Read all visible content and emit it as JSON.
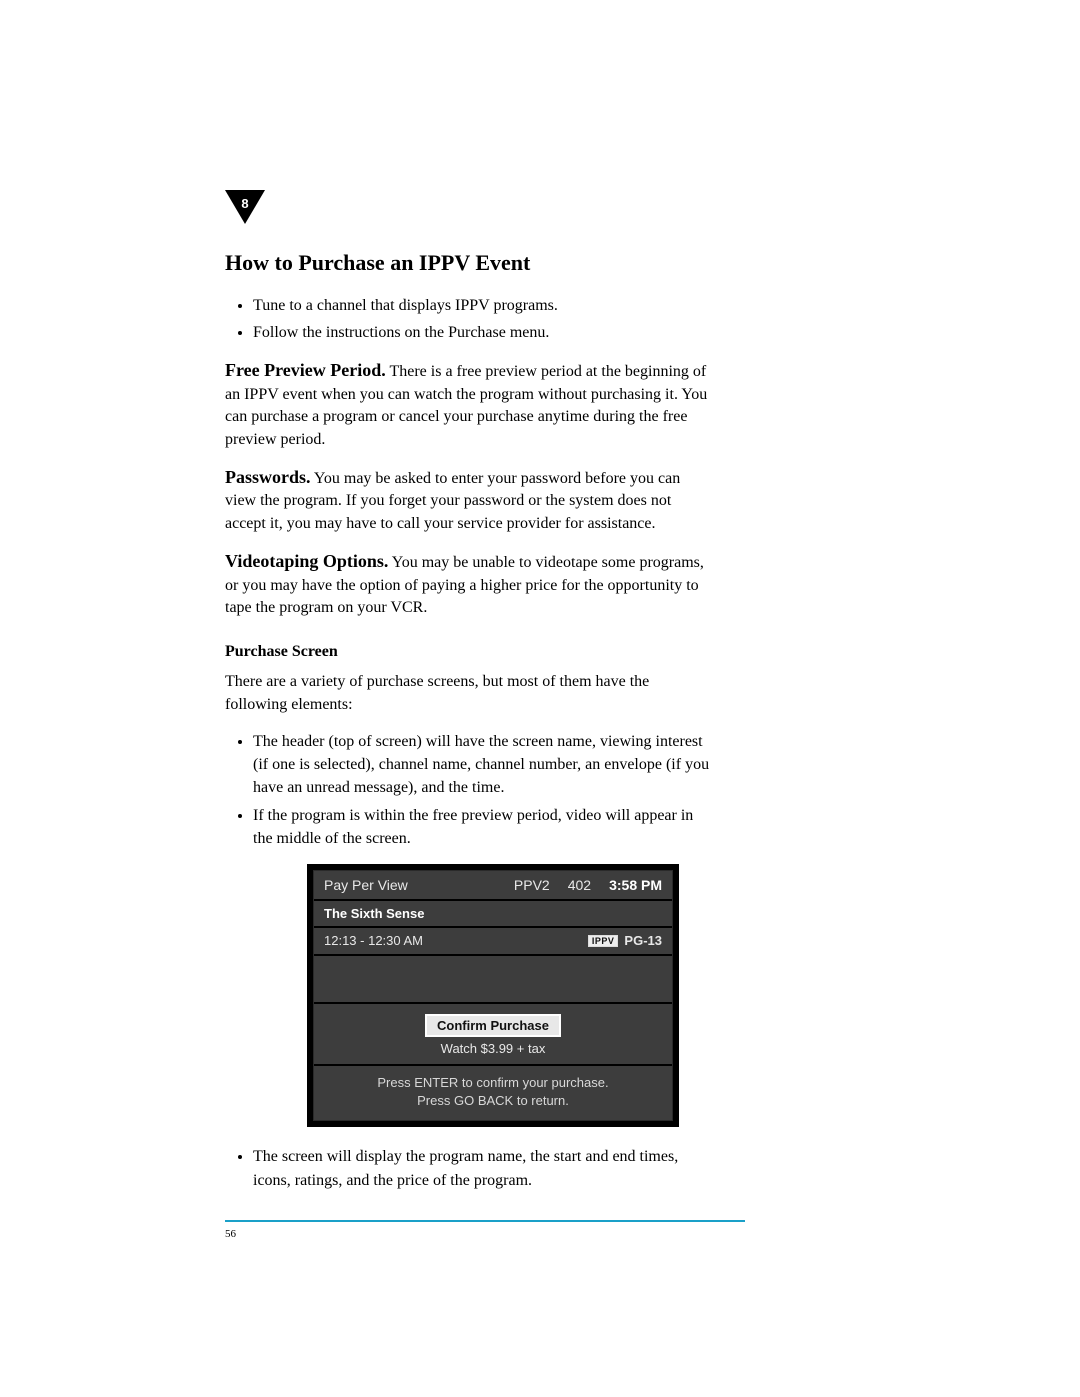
{
  "chapter_number": "8",
  "page_number": "56",
  "heading": "How to Purchase an IPPV Event",
  "intro_bullets": [
    "Tune to a channel that displays IPPV programs.",
    "Follow the instructions on the Purchase menu."
  ],
  "paragraphs": {
    "free_preview": {
      "runin": "Free Preview Period.",
      "body": " There is a free preview period at the beginning of an IPPV event when you can watch the program without purchasing it. You can purchase a program or cancel your purchase anytime during the free preview period."
    },
    "passwords": {
      "runin": "Passwords.",
      "body": " You may be asked to enter your password before you can view the program. If you forget your password or the system does not accept it, you may have to call your service provider for assistance."
    },
    "videotaping": {
      "runin": "Videotaping Options.",
      "body": " You may be unable to videotape some programs, or you may have the option of paying a higher price for the opportunity to tape the program on your VCR."
    }
  },
  "subhead": "Purchase Screen",
  "subhead_intro": "There are a variety of purchase screens, but most of them have the following elements:",
  "sub_bullets_before": [
    "The header (top of screen) will have the screen name, viewing interest (if one is selected), channel name, channel number, an envelope (if you have an unread message), and the time.",
    "If the program is within the free preview period, video will appear in the middle of the screen."
  ],
  "sub_bullets_after": [
    "The screen will display the program name, the start and end times, icons, ratings, and the price of the program."
  ],
  "tv": {
    "screen_name": "Pay Per View",
    "channel_name": "PPV2",
    "channel_number": "402",
    "time": "3:58 PM",
    "program_title": "The Sixth Sense",
    "program_time": "12:13 - 12:30 AM",
    "ippv_badge": "IPPV",
    "rating": "PG-13",
    "confirm_button": "Confirm Purchase",
    "price_line": "Watch $3.99 + tax",
    "footer_line1": "Press ENTER to confirm your purchase.",
    "footer_line2": "Press GO BACK to return."
  }
}
